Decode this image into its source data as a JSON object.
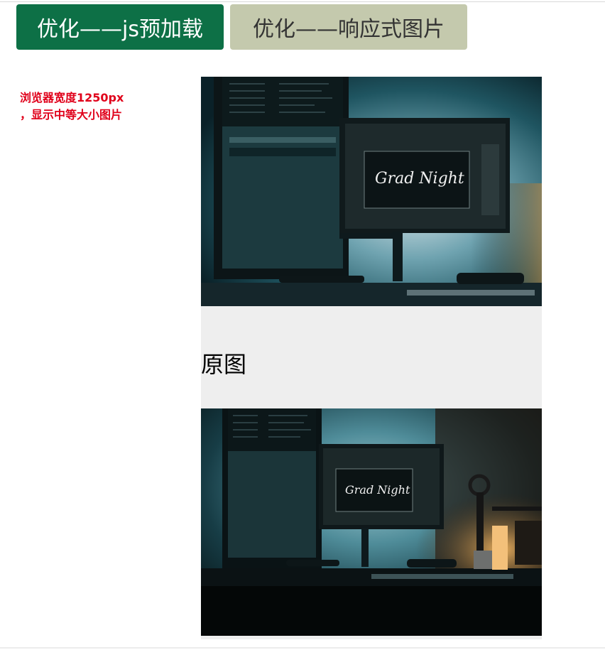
{
  "tabs": [
    {
      "label": "优化——js预加载",
      "active": true
    },
    {
      "label": "优化——响应式图片",
      "active": false
    }
  ],
  "note": {
    "line1": "浏览器宽度1250px",
    "line2": "，显示中等大小图片"
  },
  "images": [
    {
      "screen_text": "Grad Night"
    },
    {
      "screen_text": "Grad Night"
    }
  ],
  "caption": "原图",
  "colors": {
    "active_tab": "#0d7046",
    "inactive_tab": "#c4c9ad",
    "note_text": "#e0001a",
    "content_bg": "#eeeeee"
  }
}
